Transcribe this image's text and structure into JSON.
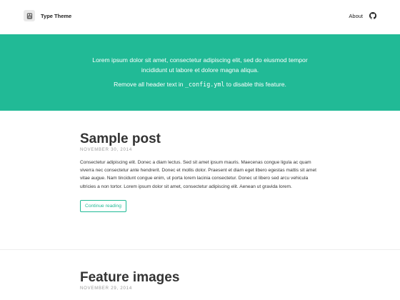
{
  "header": {
    "site_title": "Type Theme",
    "logo_icon": "theme-logo-icon",
    "nav": {
      "about_label": "About",
      "github_icon": "github-icon"
    }
  },
  "hero": {
    "line1": "Lorem ipsum dolor sit amet, consectetur adipiscing elit, sed do eiusmod tempor",
    "line1b": "incididunt ut labore et dolore magna aliqua.",
    "line2_before": "Remove all header text in ",
    "line2_code": "_config.yml",
    "line2_after": " to disable this feature.",
    "background_color": "#21ba96"
  },
  "posts": [
    {
      "title": "Sample post",
      "date": "NOVEMBER 30, 2014",
      "excerpt": "Consectetur adipiscing elit. Donec a diam lectus. Sed sit amet ipsum mauris. Maecenas congue ligula ac quam viverra nec consectetur ante hendrerit. Donec et mollis dolor. Praesent et diam eget libero egestas mattis sit amet vitae augue. Nam tincidunt congue enim, ut porta lorem lacinia consectetur. Donec ut libero sed arcu vehicula ultricies a non tortor. Lorem ipsum dolor sit amet, consectetur adipiscing elit. Aenean ut gravida lorem.",
      "button_label": "Continue reading"
    },
    {
      "title": "Feature images",
      "date": "NOVEMBER 29, 2014"
    }
  ]
}
